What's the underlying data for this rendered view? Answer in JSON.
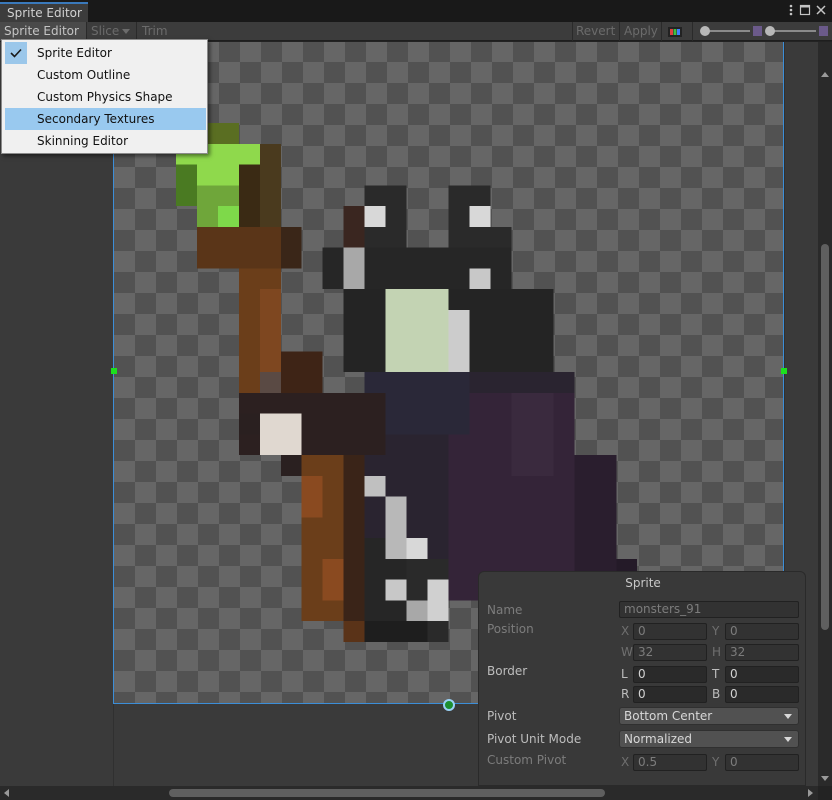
{
  "window": {
    "tab_title": "Sprite Editor",
    "menu_icon": "kebab-icon",
    "maximize_icon": "maximize-icon",
    "close_icon": "close-icon"
  },
  "toolbar": {
    "mode_dropdown": "Sprite Editor",
    "slice": "Slice",
    "trim": "Trim",
    "revert": "Revert",
    "apply": "Apply",
    "channel_icon": "color-channels-icon",
    "mip_icon": "mip-level-icon",
    "zoom_icon": "zoom-icon"
  },
  "menu": {
    "items": [
      {
        "label": "Sprite Editor",
        "checked": true
      },
      {
        "label": "Custom Outline"
      },
      {
        "label": "Custom Physics Shape"
      },
      {
        "label": "Secondary Textures",
        "highlighted": true
      },
      {
        "label": "Skinning Editor"
      }
    ]
  },
  "panel": {
    "title": "Sprite",
    "name_label": "Name",
    "name_value": "monsters_91",
    "position_label": "Position",
    "x_label": "X",
    "x_value": "0",
    "y_label": "Y",
    "y_value": "0",
    "w_label": "W",
    "w_value": "32",
    "h_label": "H",
    "h_value": "32",
    "border_label": "Border",
    "l_label": "L",
    "l_value": "0",
    "t_label": "T",
    "t_value": "0",
    "r_label": "R",
    "r_value": "0",
    "b_label": "B",
    "b_value": "0",
    "pivot_label": "Pivot",
    "pivot_value": "Bottom Center",
    "pivot_unit_label": "Pivot Unit Mode",
    "pivot_unit_value": "Normalized",
    "custom_pivot_label": "Custom Pivot",
    "cp_x_label": "X",
    "cp_x_value": "0.5",
    "cp_y_label": "Y",
    "cp_y_value": "0"
  },
  "colors": {
    "accent": "#3a79bb",
    "menu_highlight": "#99c9ef",
    "handle": "#1de01d",
    "sprite_border": "#3c8ed8"
  }
}
